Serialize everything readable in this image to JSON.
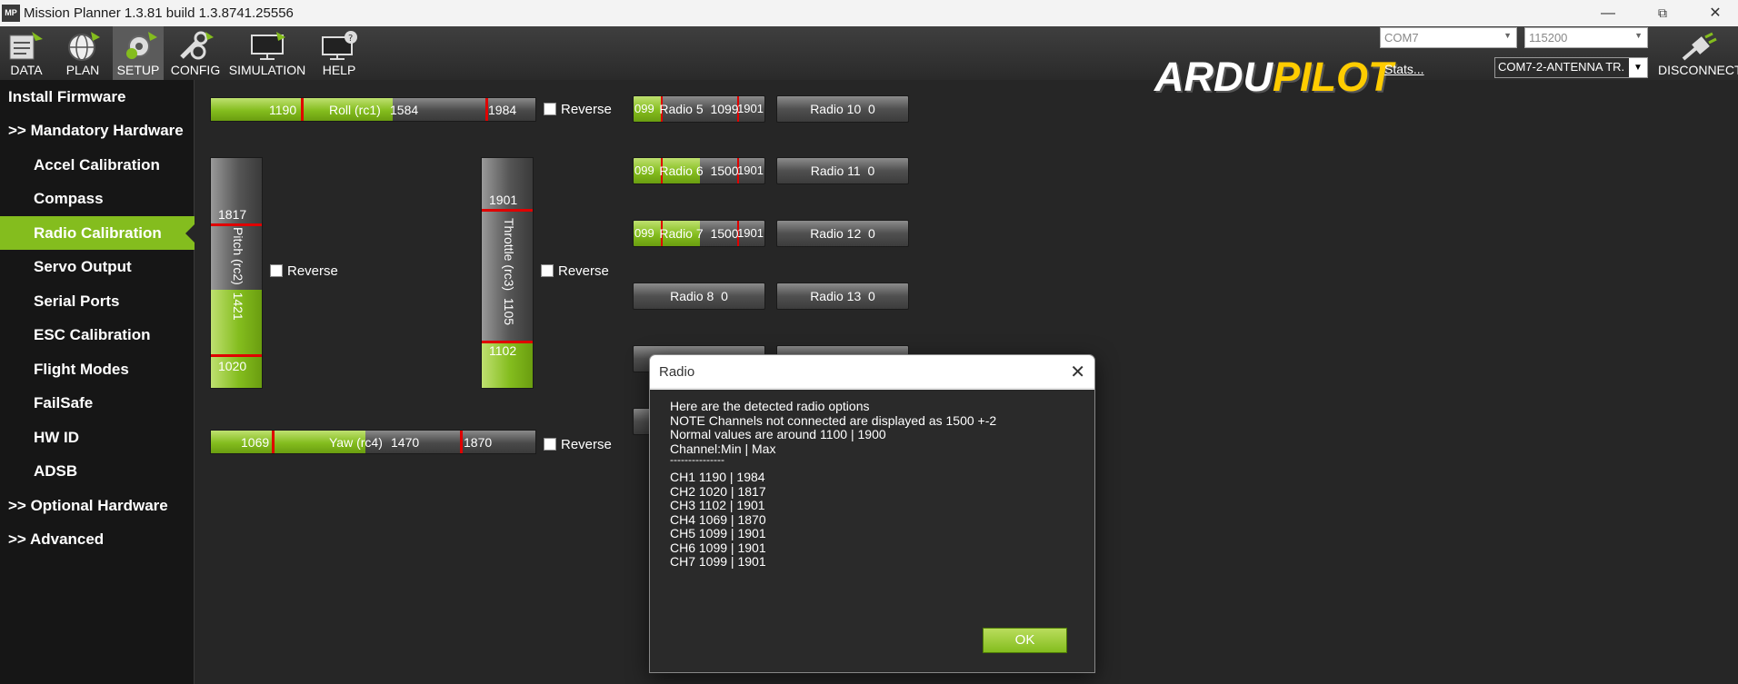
{
  "window": {
    "title": "Mission Planner 1.3.81 build 1.3.8741.25556",
    "icon_text": "MP"
  },
  "toolbar": {
    "buttons": [
      {
        "label": "DATA"
      },
      {
        "label": "PLAN"
      },
      {
        "label": "SETUP"
      },
      {
        "label": "CONFIG"
      },
      {
        "label": "SIMULATION"
      },
      {
        "label": "HELP"
      }
    ],
    "logo_ardu": "ARDU",
    "logo_pilot": "PILOT",
    "port": "COM7",
    "baud": "115200",
    "stats": "Stats...",
    "connection": "COM7-2-ANTENNA TR.",
    "disconnect": "DISCONNECT"
  },
  "sidebar": {
    "items": [
      {
        "label": "Install Firmware"
      },
      {
        "label": ">> Mandatory Hardware"
      },
      {
        "label": "Accel Calibration"
      },
      {
        "label": "Compass"
      },
      {
        "label": "Radio Calibration"
      },
      {
        "label": "Servo Output"
      },
      {
        "label": "Serial Ports"
      },
      {
        "label": "ESC Calibration"
      },
      {
        "label": "Flight Modes"
      },
      {
        "label": "FailSafe"
      },
      {
        "label": "HW ID"
      },
      {
        "label": "ADSB"
      },
      {
        "label": ">> Optional Hardware"
      },
      {
        "label": ">> Advanced"
      }
    ]
  },
  "channels": {
    "roll": {
      "min": "1190",
      "name": "Roll (rc1)",
      "value": "1584",
      "max": "1984",
      "reverse": "Reverse"
    },
    "pitch": {
      "max": "1817",
      "name": "Pitch (rc2)",
      "value": "1421",
      "min": "1020",
      "reverse": "Reverse"
    },
    "throttle": {
      "max": "1901",
      "name": "Throttle (rc3)",
      "value": "1105",
      "min": "1102",
      "reverse": "Reverse"
    },
    "yaw": {
      "min": "1069",
      "name": "Yaw (rc4)",
      "value": "1470",
      "max": "1870",
      "reverse": "Reverse"
    }
  },
  "radio_buttons": {
    "r5": {
      "min": "099",
      "label": "Radio 5",
      "value": "1099",
      "max": "1901"
    },
    "r6": {
      "min": "099",
      "label": "Radio 6",
      "value": "1500",
      "max": "1901"
    },
    "r7": {
      "min": "099",
      "label": "Radio 7",
      "value": "1500",
      "max": "1901"
    },
    "r8": {
      "label": "Radio 8",
      "value": "0"
    },
    "r10": {
      "label": "Radio 10",
      "value": "0"
    },
    "r11": {
      "label": "Radio 11",
      "value": "0"
    },
    "r12": {
      "label": "Radio 12",
      "value": "0"
    },
    "r13": {
      "label": "Radio 13",
      "value": "0"
    }
  },
  "dialog": {
    "title": "Radio",
    "close": "✕",
    "lines": [
      "Here are the detected radio options",
      "NOTE Channels not connected are displayed as 1500 +-2",
      "Normal values are around 1100 | 1900",
      "Channel:Min | Max",
      "---------------",
      "CH1 1190 | 1984",
      "CH2 1020 | 1817",
      "CH3 1102 | 1901",
      "CH4 1069 | 1870",
      "CH5 1099 | 1901",
      "CH6 1099 | 1901",
      "CH7 1099 | 1901"
    ],
    "ok": "OK"
  }
}
